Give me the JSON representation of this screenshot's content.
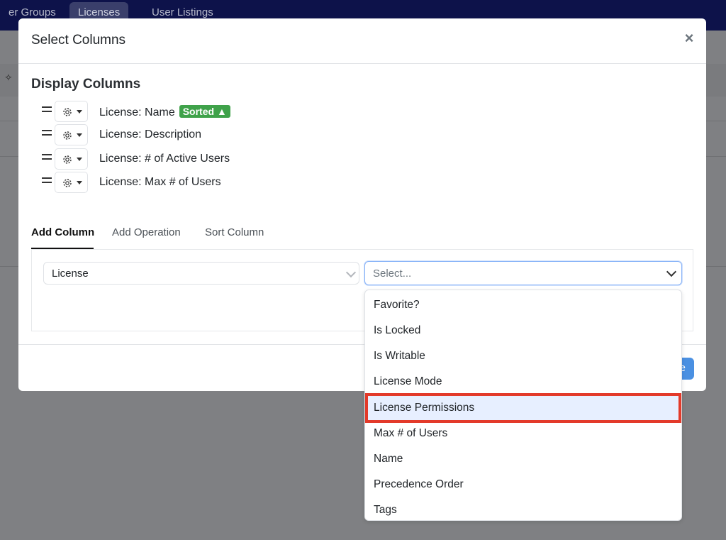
{
  "topnav": {
    "tabs": [
      {
        "label": "er Groups",
        "active": false
      },
      {
        "label": "Licenses",
        "active": true
      },
      {
        "label": "User Listings",
        "active": false
      }
    ]
  },
  "modal": {
    "title": "Select Columns",
    "close_label": "×",
    "display_columns_title": "Display Columns",
    "columns": [
      {
        "label": "License: Name",
        "badge": "Sorted ▲"
      },
      {
        "label": "License: Description"
      },
      {
        "label": "License: # of Active Users"
      },
      {
        "label": "License: Max # of Users"
      }
    ],
    "tabs": [
      {
        "label": "Add Column",
        "active": true
      },
      {
        "label": "Add Operation",
        "active": false
      },
      {
        "label": "Sort Column",
        "active": false
      }
    ],
    "entity_select": {
      "value": "License"
    },
    "field_select": {
      "placeholder": "Select..."
    },
    "save_label": "e"
  },
  "dropdown": {
    "options": [
      "Favorite?",
      "Is Locked",
      "Is Writable",
      "License Mode",
      "License Permissions",
      "Max # of Users",
      "Name",
      "Precedence Order",
      "Tags"
    ],
    "highlighted_index": 4
  },
  "colors": {
    "nav_bg": "#0d124a",
    "badge_green": "#3fa24a",
    "highlight_red": "#e33a2a",
    "primary_blue": "#4a90e2"
  }
}
